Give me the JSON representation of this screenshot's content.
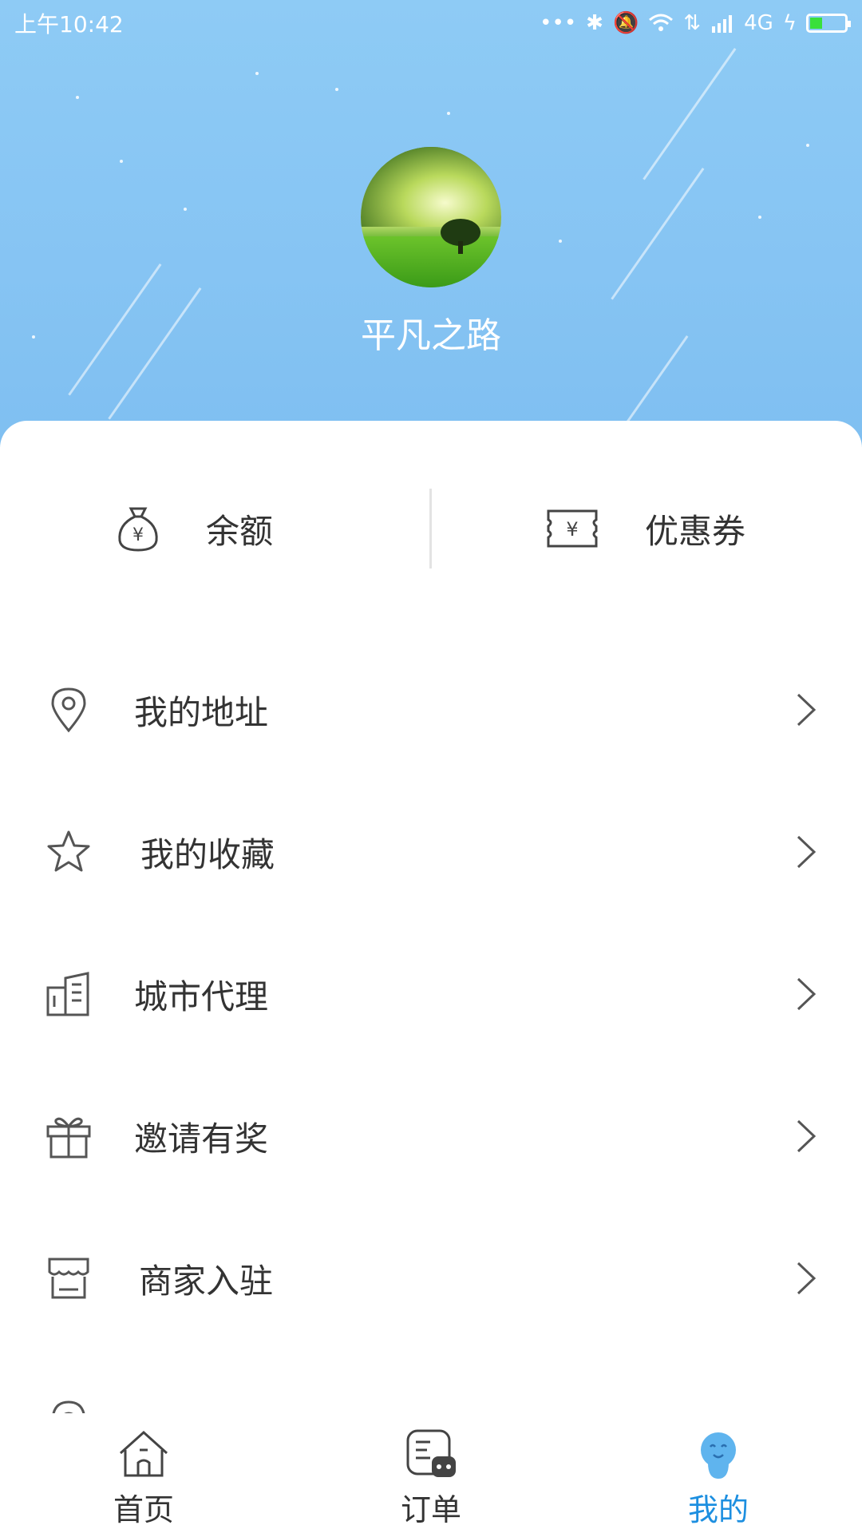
{
  "status_bar": {
    "time": "上午10:42",
    "network": "4G",
    "battery_level": 0.35
  },
  "profile": {
    "username": "平凡之路"
  },
  "quick_actions": [
    {
      "label": "余额",
      "icon": "money-bag-icon"
    },
    {
      "label": "优惠券",
      "icon": "coupon-icon"
    }
  ],
  "menu": [
    {
      "label": "我的地址",
      "icon": "location-pin-icon"
    },
    {
      "label": "我的收藏",
      "icon": "star-icon"
    },
    {
      "label": "城市代理",
      "icon": "building-icon"
    },
    {
      "label": "邀请有奖",
      "icon": "gift-icon"
    },
    {
      "label": "商家入驻",
      "icon": "store-icon"
    }
  ],
  "bottom_nav": [
    {
      "label": "首页",
      "icon": "home-icon",
      "active": false
    },
    {
      "label": "订单",
      "icon": "order-icon",
      "active": false
    },
    {
      "label": "我的",
      "icon": "profile-face-icon",
      "active": true
    }
  ],
  "colors": {
    "header": "#86c4f3",
    "active_tab": "#1d8fe0",
    "text": "#333333"
  }
}
